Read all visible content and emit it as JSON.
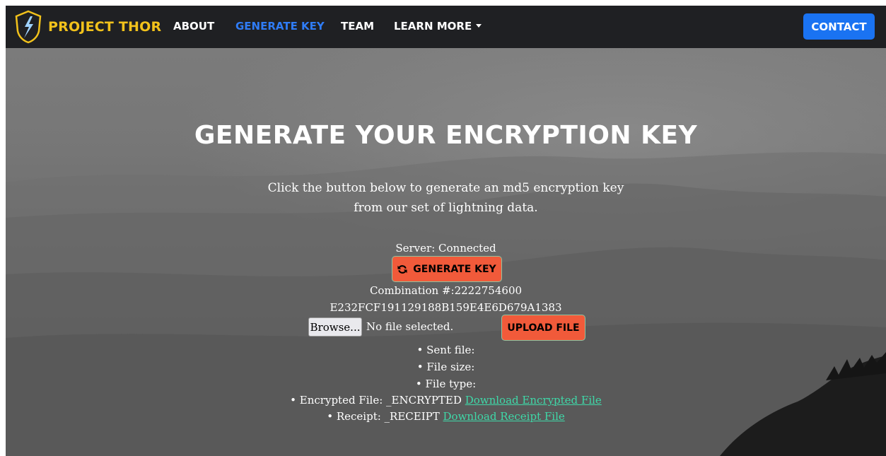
{
  "nav": {
    "brand": "PROJECT THOR",
    "links": [
      {
        "label": "ABOUT"
      },
      {
        "label": "GENERATE KEY"
      },
      {
        "label": "TEAM"
      },
      {
        "label": "LEARN MORE"
      }
    ],
    "contact": "CONTACT",
    "colors": {
      "brand": "#f2c21b",
      "active": "#2f7cf6",
      "contact_bg": "#1a73f2"
    }
  },
  "hero": {
    "title": "GENERATE YOUR ENCRYPTION KEY",
    "lead": "Click the button below to generate an md5 encryption key from our set of lightning data."
  },
  "generator": {
    "server_status": "Server: Connected",
    "generate_label": "GENERATE KEY",
    "generate_icon": "refresh-icon",
    "combination": "Combination #:2222754600",
    "key": "E232FCF191129188B159E4E6D679A1383",
    "browse_label": "Browse...",
    "file_status": "No file selected.",
    "upload_label": "UPLOAD FILE",
    "button_color": "#f15a3a"
  },
  "results": {
    "sent_file": "Sent file:",
    "file_size": "File size:",
    "file_type": "File type:",
    "encrypted_label": "Encrypted File: _ENCRYPTED",
    "encrypted_link": "Download Encrypted File",
    "receipt_label": "Receipt: _RECEIPT",
    "receipt_link": "Download Receipt File",
    "link_color": "#3fd8a8"
  }
}
